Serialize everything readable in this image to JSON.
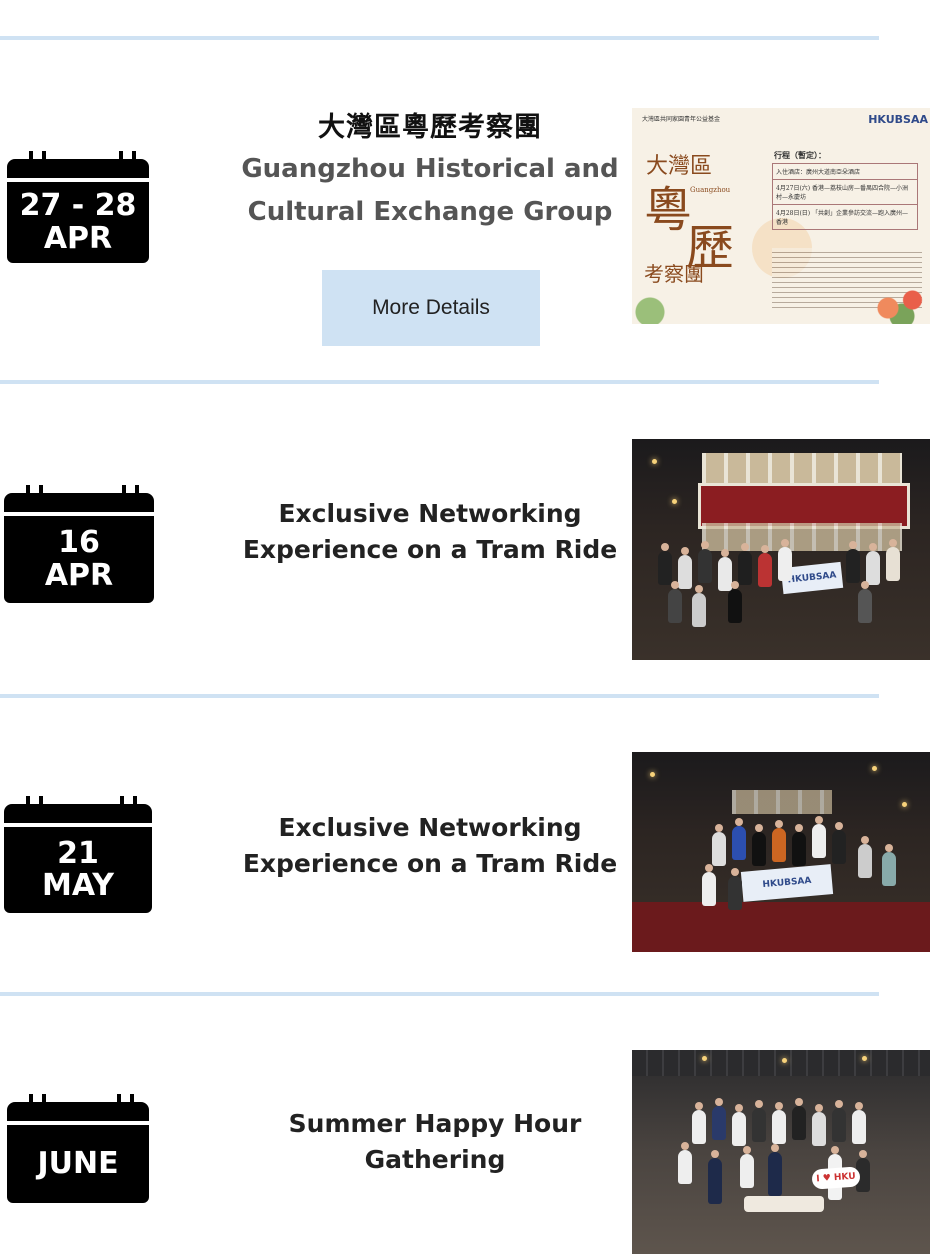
{
  "events": [
    {
      "date_line1": "27 - 28",
      "date_line2": "APR",
      "title_zh": "大灣區粵歷考察團",
      "title_en_line1": "Guangzhou Historical and",
      "title_en_line2": "Cultural Exchange Group",
      "button_label": "More Details",
      "photo": "event-poster",
      "poster": {
        "org": "大灣區共同家園青年公益基金",
        "logo": "HKUBSAA",
        "big_chars": [
          "大灣區",
          "粵",
          "歷",
          "考察團"
        ],
        "side_word": "Guangzhou",
        "schedule_heading": "行程（暫定）：",
        "rows": [
          "入住酒店：廣州大道南亞朵酒店",
          "4月27日(六)  香港—荔枝山房—番禺四合院—小洲村—永慶坊",
          "4月28日(日)  「共創」企業參訪交流—跑入廣州—香港"
        ]
      }
    },
    {
      "date_line1": "16",
      "date_line2": "APR",
      "title_line1": "Exclusive Networking",
      "title_line2": "Experience on a Tram Ride",
      "photo": "tram-group-photo",
      "banner_text": "HKUBSAA"
    },
    {
      "date_line1": "21",
      "date_line2": "MAY",
      "title_line1": "Exclusive Networking",
      "title_line2": "Experience on a Tram Ride",
      "photo": "tram-top-deck-photo",
      "banner_text": "HKUBSAA"
    },
    {
      "date_line1": "JUNE",
      "title_line1": "Summer Happy Hour",
      "title_line2": "Gathering",
      "photo": "happy-hour-photo",
      "sign_text": "I ♥ HKU"
    }
  ],
  "colors": {
    "divider": "#cfe2f3",
    "button_bg": "#cfe2f3",
    "calendar": "#000000"
  }
}
